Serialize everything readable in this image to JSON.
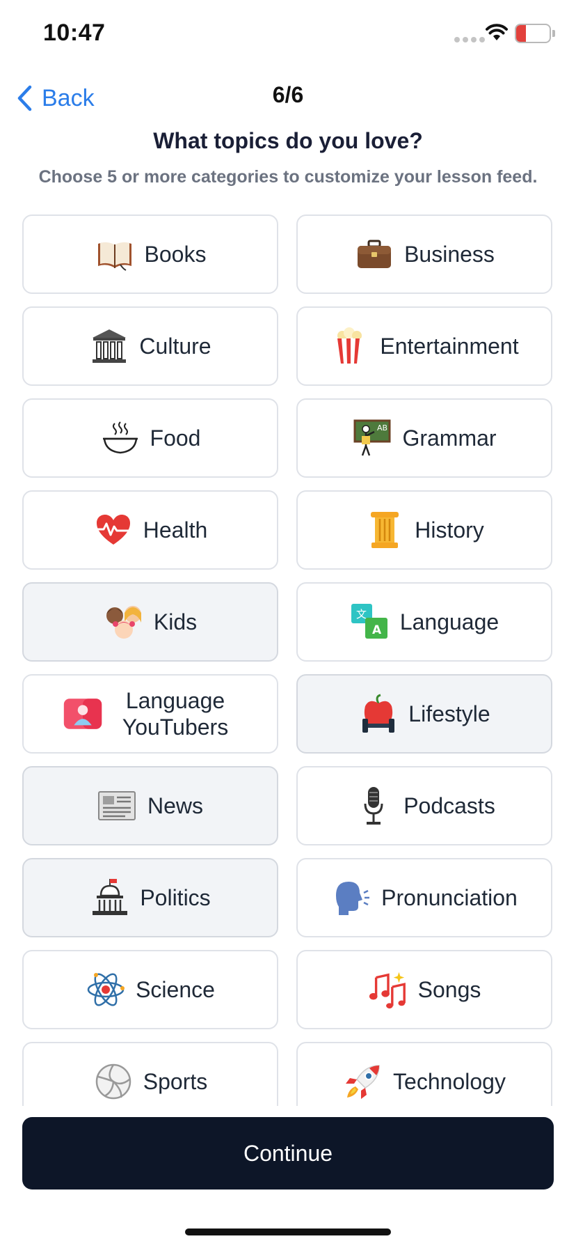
{
  "status_bar": {
    "time": "10:47",
    "battery": "13"
  },
  "nav": {
    "back_label": "Back",
    "progress": "6/6"
  },
  "header": {
    "title": "What topics do you love?",
    "subtitle": "Choose 5 or more categories to customize your lesson feed."
  },
  "topics": [
    {
      "label": "Books",
      "icon": "open-book-icon",
      "selected": false
    },
    {
      "label": "Business",
      "icon": "briefcase-icon",
      "selected": false
    },
    {
      "label": "Culture",
      "icon": "classical-building-icon",
      "selected": false
    },
    {
      "label": "Entertainment",
      "icon": "popcorn-icon",
      "selected": false
    },
    {
      "label": "Food",
      "icon": "steaming-bowl-icon",
      "selected": false
    },
    {
      "label": "Grammar",
      "icon": "teacher-chalkboard-icon",
      "selected": false
    },
    {
      "label": "Health",
      "icon": "heart-pulse-icon",
      "selected": false
    },
    {
      "label": "History",
      "icon": "greek-column-icon",
      "selected": false
    },
    {
      "label": "Kids",
      "icon": "children-faces-icon",
      "selected": true
    },
    {
      "label": "Language",
      "icon": "translate-icon",
      "selected": false
    },
    {
      "label": "Language YouTubers",
      "icon": "video-profile-icon",
      "selected": false
    },
    {
      "label": "Lifestyle",
      "icon": "apple-dumbbell-icon",
      "selected": true
    },
    {
      "label": "News",
      "icon": "newspaper-icon",
      "selected": true
    },
    {
      "label": "Podcasts",
      "icon": "microphone-icon",
      "selected": false
    },
    {
      "label": "Politics",
      "icon": "capitol-building-icon",
      "selected": true
    },
    {
      "label": "Pronunciation",
      "icon": "speaking-head-icon",
      "selected": false
    },
    {
      "label": "Science",
      "icon": "atom-icon",
      "selected": false
    },
    {
      "label": "Songs",
      "icon": "music-notes-icon",
      "selected": false
    },
    {
      "label": "Sports",
      "icon": "volleyball-icon",
      "selected": false
    },
    {
      "label": "Technology",
      "icon": "rocket-icon",
      "selected": false
    }
  ],
  "continue_label": "Continue",
  "colors": {
    "accent": "#2b7de9",
    "button": "#0d1628",
    "selected_tile": "#f2f4f7",
    "tile_border": "#dfe2e8"
  }
}
